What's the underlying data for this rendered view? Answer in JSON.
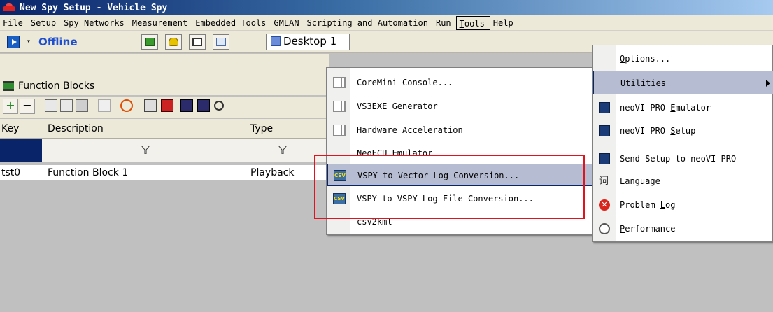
{
  "window": {
    "title": "New Spy Setup - Vehicle Spy"
  },
  "menubar": {
    "items": [
      {
        "label": "File",
        "hotkey": "F",
        "rest": "ile"
      },
      {
        "label": "Setup",
        "hotkey": "S",
        "rest": "etup"
      },
      {
        "label": "Spy Networks",
        "hotkey": "",
        "rest": "Spy Networks"
      },
      {
        "label": "Measurement",
        "hotkey": "M",
        "rest": "easurement"
      },
      {
        "label": "Embedded Tools",
        "hotkey": "E",
        "rest": "mbedded Tools"
      },
      {
        "label": "GMLAN",
        "hotkey": "G",
        "rest": "MLAN"
      },
      {
        "label": "Scripting and Automation",
        "pre": "Scripting and ",
        "hotkey": "A",
        "rest": "utomation"
      },
      {
        "label": "Run",
        "hotkey": "R",
        "rest": "un"
      },
      {
        "label": "Tools",
        "hotkey": "T",
        "rest": "ools"
      },
      {
        "label": "Help",
        "hotkey": "H",
        "rest": "elp"
      }
    ]
  },
  "toolbar": {
    "status_label": "Offline",
    "desktop_tab": "Desktop 1",
    "dropdown_arrow": "▾"
  },
  "function_blocks": {
    "panel_title": "Function Blocks",
    "columns": {
      "key": "Key",
      "description": "Description",
      "type": "Type"
    },
    "rows": [
      {
        "key": "tst0",
        "description": "Function Block 1",
        "type": "Playback"
      }
    ]
  },
  "utilities_submenu": {
    "items": [
      {
        "label": "CoreMini Console...",
        "icon": "grid-icon"
      },
      {
        "label": "VS3EXE Generator",
        "icon": "grid-icon"
      },
      {
        "label": "Hardware Acceleration",
        "icon": "grid-icon"
      },
      {
        "label": "NeoECU Emulator",
        "icon": ""
      },
      {
        "label": "VSPY to Vector Log Conversion...",
        "icon": "csv-icon",
        "highlighted": true
      },
      {
        "label": "VSPY to VSPY Log File Conversion...",
        "icon": "csv-icon"
      },
      {
        "label": "csv2kml",
        "icon": ""
      }
    ]
  },
  "tools_menu": {
    "items": [
      {
        "label": "Options...",
        "hotkey": "O",
        "rest": "ptions...",
        "icon": ""
      },
      {
        "label": "Utilities",
        "hotkey": "",
        "rest": "Utilities",
        "icon": "",
        "highlighted": true,
        "has_submenu": true
      },
      {
        "label": "neoVI PRO Emulator",
        "pre": "neoVI PRO ",
        "hotkey": "E",
        "rest": "mulator",
        "icon": "neovi-icon"
      },
      {
        "label": "neoVI PRO Setup",
        "pre": "neoVI PRO ",
        "hotkey": "S",
        "rest": "etup",
        "icon": "neovi-icon"
      },
      {
        "label": "Send Setup to neoVI PRO",
        "hotkey": "",
        "rest": "Send Setup to neoVI PRO",
        "icon": "neovi-icon"
      },
      {
        "label": "Language",
        "hotkey": "L",
        "rest": "anguage",
        "icon": "language-icon",
        "glyph": "词"
      },
      {
        "label": "Problem Log",
        "pre": "Problem ",
        "hotkey": "L",
        "rest": "og",
        "icon": "problem-icon"
      },
      {
        "label": "Performance",
        "hotkey": "P",
        "rest": "erformance",
        "icon": "performance-icon"
      }
    ]
  },
  "colors": {
    "title_gradient_start": "#0a246a",
    "menu_highlight": "#b6bdd2",
    "annotation_red": "#e0141e",
    "offline_blue": "#1e4fd0"
  }
}
